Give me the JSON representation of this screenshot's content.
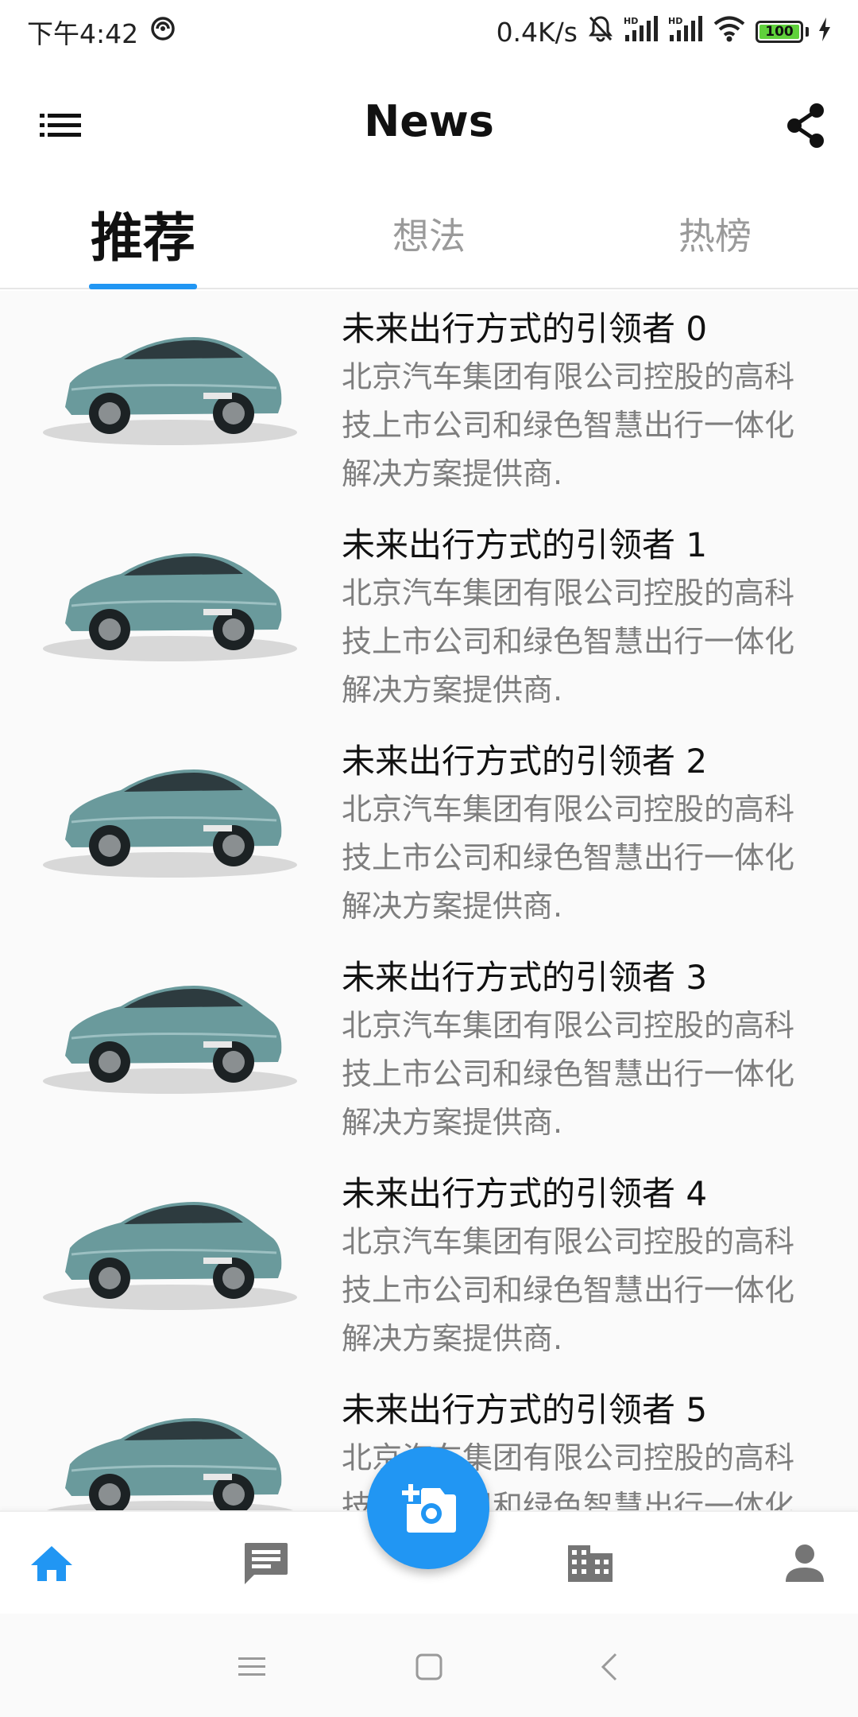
{
  "status_bar": {
    "time": "下午4:42",
    "net_speed": "0.4K/s",
    "battery_level": "100"
  },
  "app_bar": {
    "title": "News",
    "menu_icon": "list-icon",
    "share_icon": "share-icon"
  },
  "tabs": [
    {
      "label": "推荐",
      "active": true
    },
    {
      "label": "想法",
      "active": false
    },
    {
      "label": "热榜",
      "active": false
    }
  ],
  "news": {
    "items": [
      {
        "title": "未来出行方式的引领者 0",
        "desc": "北京汽车集团有限公司控股的高科技上市公司和绿色智慧出行一体化解决方案提供商."
      },
      {
        "title": "未来出行方式的引领者 1",
        "desc": "北京汽车集团有限公司控股的高科技上市公司和绿色智慧出行一体化解决方案提供商."
      },
      {
        "title": "未来出行方式的引领者 2",
        "desc": "北京汽车集团有限公司控股的高科技上市公司和绿色智慧出行一体化解决方案提供商."
      },
      {
        "title": "未来出行方式的引领者 3",
        "desc": "北京汽车集团有限公司控股的高科技上市公司和绿色智慧出行一体化解决方案提供商."
      },
      {
        "title": "未来出行方式的引领者 4",
        "desc": "北京汽车集团有限公司控股的高科技上市公司和绿色智慧出行一体化解决方案提供商."
      },
      {
        "title": "未来出行方式的引领者 5",
        "desc": "北京汽车集团有限公司控股的高科技上市公司和绿色智慧出行一体化解决方案提供商."
      }
    ]
  },
  "bottom_nav": [
    {
      "icon": "home-icon",
      "active": true
    },
    {
      "icon": "message-icon",
      "active": false
    },
    {
      "icon": "building-icon",
      "active": false
    },
    {
      "icon": "person-icon",
      "active": false
    }
  ],
  "fab": {
    "icon": "add-photo-icon"
  },
  "colors": {
    "accent": "#2196f3",
    "inactive_icon": "#757575",
    "desc_text": "#7e7e7e",
    "car_body": "#6a9a9c"
  }
}
